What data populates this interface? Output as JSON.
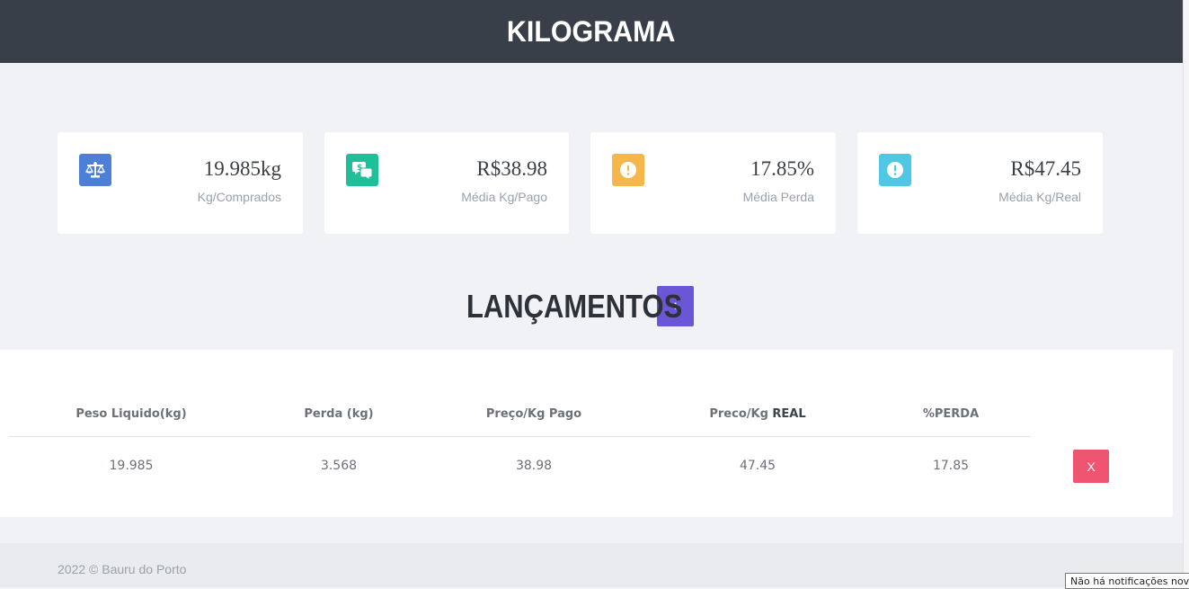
{
  "header": {
    "title": "KILOGRAMA",
    "bg": "#383f48"
  },
  "cards": [
    {
      "value": "19.985kg",
      "label": "Kg/Comprados",
      "icon": "scale-icon",
      "color": "#4e7fd8"
    },
    {
      "value": "R$38.98",
      "label": "Média Kg/Pago",
      "icon": "money-chat-icon",
      "color": "#1fbf99"
    },
    {
      "value": "17.85%",
      "label": "Média Perda",
      "icon": "alert-icon",
      "color": "#f6b74a"
    },
    {
      "value": "R$47.45",
      "label": "Média Kg/Real",
      "icon": "alert-icon",
      "color": "#4fc8e6"
    }
  ],
  "section": {
    "title": "LANÇAMENTOS",
    "add_label": "+",
    "add_color": "#6b57d6"
  },
  "table": {
    "headers": [
      "Peso Liquido(kg)",
      "Perda (kg)",
      "Preço/Kg Pago",
      "Preco/Kg ",
      "REAL",
      "%PERDA"
    ],
    "rows": [
      {
        "cells": [
          "19.985",
          "3.568",
          "38.98",
          "47.45",
          "17.85"
        ],
        "delete_label": "X"
      }
    ],
    "delete_color": "#ef5570"
  },
  "footer": {
    "text": "2022 © Bauru do Porto"
  },
  "notification": {
    "text": "Não há notificações novas"
  }
}
